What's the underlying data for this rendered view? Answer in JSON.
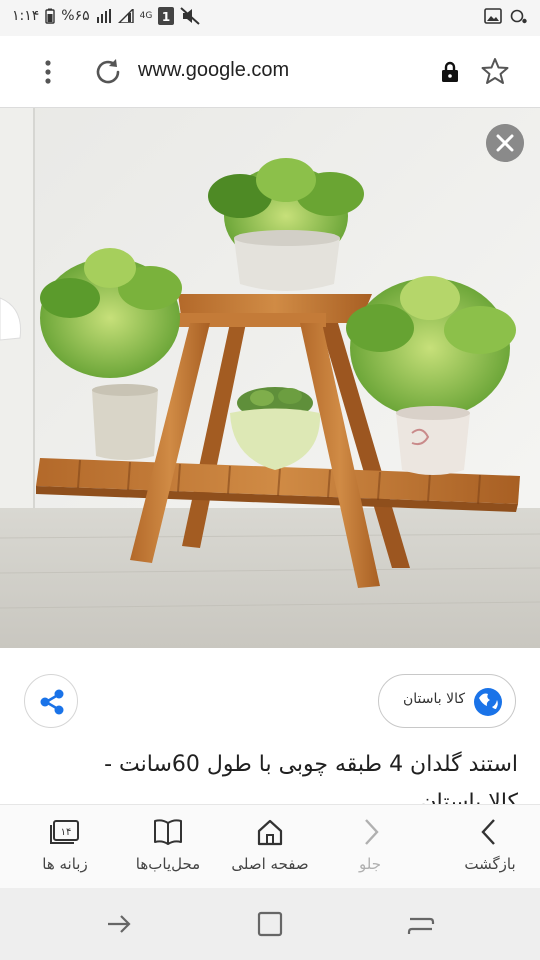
{
  "status_bar": {
    "time": "۱:۱۴",
    "battery": "%۶۵",
    "network": "4G",
    "sim_badge": "1"
  },
  "url_bar": {
    "url": "www.google.com",
    "icons": [
      "more-vert-icon",
      "reload-icon",
      "lock-icon",
      "star-icon"
    ]
  },
  "photo": {
    "close_icon": "close-icon"
  },
  "result": {
    "source_label": "کالا باستان",
    "caption_line1": "استند گلدان 4 طبقه چوبی با طول 60سانت -",
    "caption_line2": "کالا باستان"
  },
  "toolbar": {
    "back_label": "بازگشت",
    "forward_label": "جلو",
    "home_label": "صفحه اصلی",
    "bookmarks_label": "محل‌یاب‌ها",
    "tabs_label": "زبانه ها",
    "tabs_count": "۱۴"
  },
  "colors": {
    "accent_blue": "#1a73e8",
    "icon_gray": "#555555",
    "nav_bar_bg": "#eeeeee"
  }
}
